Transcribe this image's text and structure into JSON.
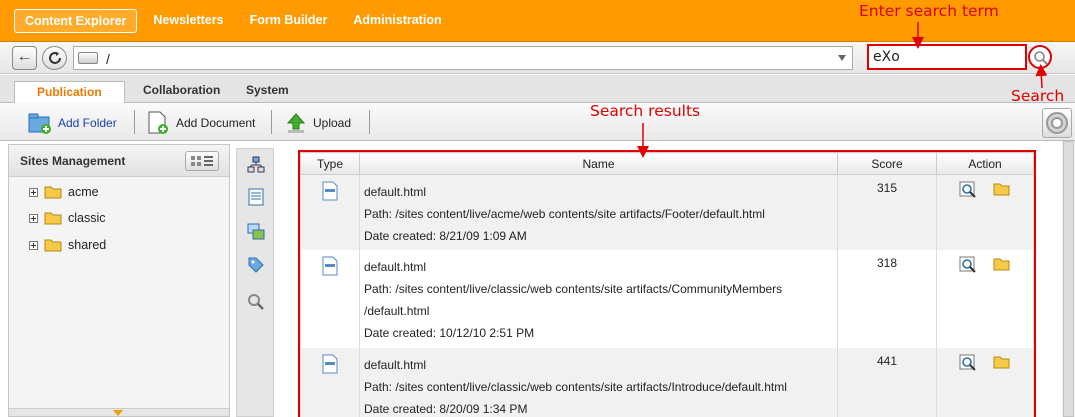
{
  "top_nav": [
    "Content Explorer",
    "Newsletters",
    "Form Builder",
    "Administration"
  ],
  "address": {
    "path": "/",
    "search_value": "eXo"
  },
  "tabs": [
    "Publication",
    "Collaboration",
    "System"
  ],
  "toolbar": {
    "add_folder": "Add Folder",
    "add_document": "Add Document",
    "upload": "Upload"
  },
  "left_panel": {
    "title": "Sites Management",
    "tree": [
      "acme",
      "classic",
      "shared"
    ]
  },
  "results": {
    "columns": [
      "Type",
      "Name",
      "Score",
      "Action"
    ],
    "rows": [
      {
        "name": "default.html",
        "path": "Path: /sites content/live/acme/web contents/site artifacts/Footer/default.html",
        "path2": "",
        "date": "Date created: 8/21/09 1:09 AM",
        "score": "315"
      },
      {
        "name": "default.html",
        "path": "Path: /sites content/live/classic/web contents/site artifacts/CommunityMembers",
        "path2": "/default.html",
        "date": "Date created: 10/12/10 2:51 PM",
        "score": "318"
      },
      {
        "name": "default.html",
        "path": "Path: /sites content/live/classic/web contents/site artifacts/Introduce/default.html",
        "path2": "",
        "date": "Date created: 8/20/09 1:34 PM",
        "score": "441"
      }
    ]
  },
  "annotations": {
    "enter_search": "Enter search term",
    "search": "Search",
    "search_results": "Search results"
  },
  "colors": {
    "brand": "#ff9b00",
    "annotation": "#e00000",
    "active_tab": "#e87a00"
  }
}
